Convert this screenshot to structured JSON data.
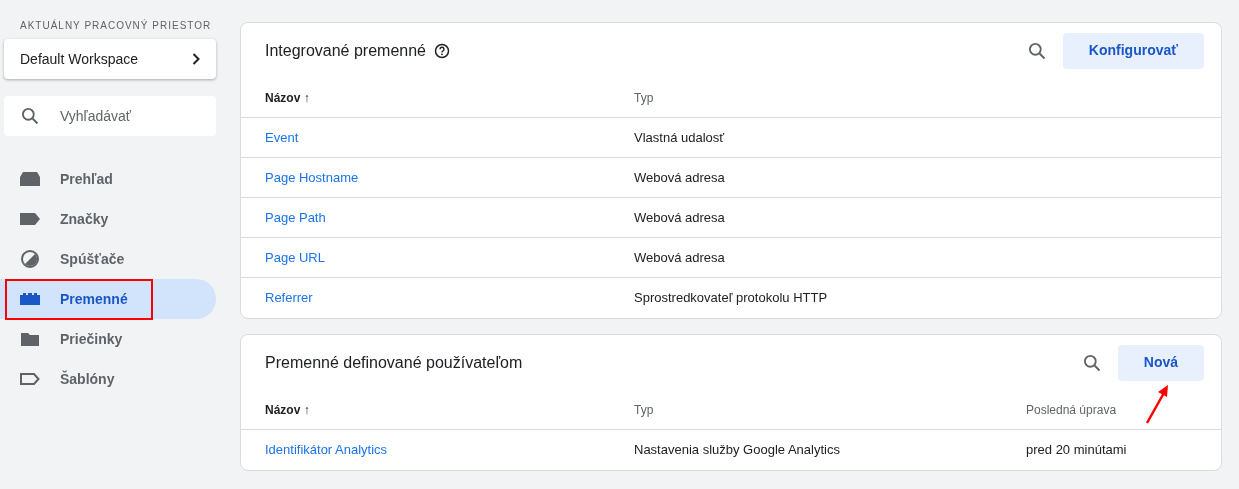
{
  "sidebar": {
    "workspace_label": "AKTUÁLNY PRACOVNÝ PRIESTOR",
    "workspace": "Default Workspace",
    "search": {
      "placeholder": "Vyhľadávať"
    },
    "items": [
      {
        "label": "Prehľad",
        "kind": "overview",
        "selected": false,
        "highlighted": false
      },
      {
        "label": "Značky",
        "kind": "tag",
        "selected": false,
        "highlighted": false
      },
      {
        "label": "Spúšťače",
        "kind": "trigger",
        "selected": false,
        "highlighted": false
      },
      {
        "label": "Premenné",
        "kind": "variable",
        "selected": true,
        "highlighted": true
      },
      {
        "label": "Priečinky",
        "kind": "folder",
        "selected": false,
        "highlighted": false
      },
      {
        "label": "Šablóny",
        "kind": "template",
        "selected": false,
        "highlighted": false
      }
    ]
  },
  "cards": [
    {
      "title": "Integrované premenné",
      "help": true,
      "button": "Konfigurovať",
      "arrow": false,
      "columns": [
        "Názov ↑",
        "Typ"
      ],
      "rows": [
        [
          "Event",
          "Vlastná udalosť"
        ],
        [
          "Page Hostname",
          "Webová adresa"
        ],
        [
          "Page Path",
          "Webová adresa"
        ],
        [
          "Page URL",
          "Webová adresa"
        ],
        [
          "Referrer",
          "Sprostredkovateľ protokolu HTTP"
        ]
      ]
    },
    {
      "title": "Premenné definované používateľom",
      "help": false,
      "button": "Nová",
      "arrow": true,
      "columns": [
        "Názov ↑",
        "Typ",
        "Posledná úprava"
      ],
      "rows": [
        [
          "Identifikátor Analytics",
          "Nastavenia služby Google Analytics",
          "pred 20 minútami"
        ]
      ]
    }
  ]
}
